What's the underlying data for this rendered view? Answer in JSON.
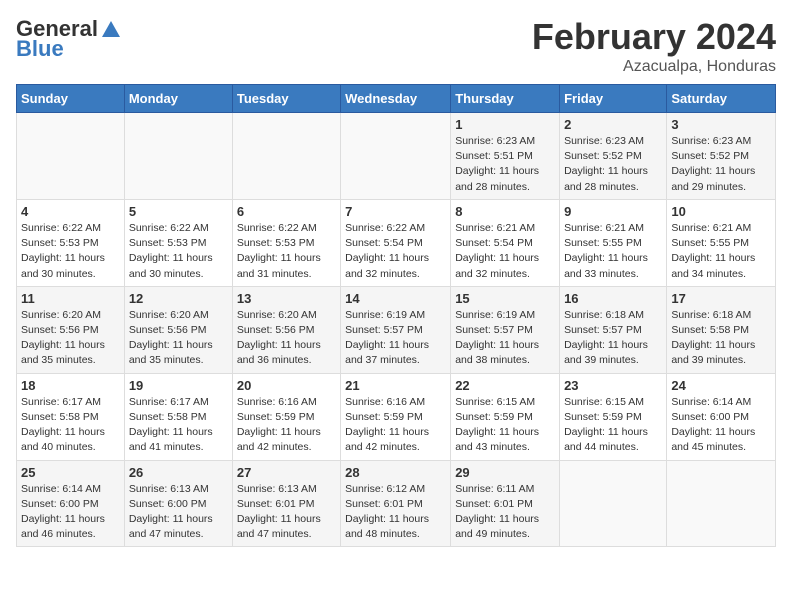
{
  "header": {
    "logo_general": "General",
    "logo_blue": "Blue",
    "title": "February 2024",
    "subtitle": "Azacualpa, Honduras"
  },
  "days_of_week": [
    "Sunday",
    "Monday",
    "Tuesday",
    "Wednesday",
    "Thursday",
    "Friday",
    "Saturday"
  ],
  "weeks": [
    [
      {
        "day": "",
        "info": ""
      },
      {
        "day": "",
        "info": ""
      },
      {
        "day": "",
        "info": ""
      },
      {
        "day": "",
        "info": ""
      },
      {
        "day": "1",
        "info": "Sunrise: 6:23 AM\nSunset: 5:51 PM\nDaylight: 11 hours and 28 minutes."
      },
      {
        "day": "2",
        "info": "Sunrise: 6:23 AM\nSunset: 5:52 PM\nDaylight: 11 hours and 28 minutes."
      },
      {
        "day": "3",
        "info": "Sunrise: 6:23 AM\nSunset: 5:52 PM\nDaylight: 11 hours and 29 minutes."
      }
    ],
    [
      {
        "day": "4",
        "info": "Sunrise: 6:22 AM\nSunset: 5:53 PM\nDaylight: 11 hours and 30 minutes."
      },
      {
        "day": "5",
        "info": "Sunrise: 6:22 AM\nSunset: 5:53 PM\nDaylight: 11 hours and 30 minutes."
      },
      {
        "day": "6",
        "info": "Sunrise: 6:22 AM\nSunset: 5:53 PM\nDaylight: 11 hours and 31 minutes."
      },
      {
        "day": "7",
        "info": "Sunrise: 6:22 AM\nSunset: 5:54 PM\nDaylight: 11 hours and 32 minutes."
      },
      {
        "day": "8",
        "info": "Sunrise: 6:21 AM\nSunset: 5:54 PM\nDaylight: 11 hours and 32 minutes."
      },
      {
        "day": "9",
        "info": "Sunrise: 6:21 AM\nSunset: 5:55 PM\nDaylight: 11 hours and 33 minutes."
      },
      {
        "day": "10",
        "info": "Sunrise: 6:21 AM\nSunset: 5:55 PM\nDaylight: 11 hours and 34 minutes."
      }
    ],
    [
      {
        "day": "11",
        "info": "Sunrise: 6:20 AM\nSunset: 5:56 PM\nDaylight: 11 hours and 35 minutes."
      },
      {
        "day": "12",
        "info": "Sunrise: 6:20 AM\nSunset: 5:56 PM\nDaylight: 11 hours and 35 minutes."
      },
      {
        "day": "13",
        "info": "Sunrise: 6:20 AM\nSunset: 5:56 PM\nDaylight: 11 hours and 36 minutes."
      },
      {
        "day": "14",
        "info": "Sunrise: 6:19 AM\nSunset: 5:57 PM\nDaylight: 11 hours and 37 minutes."
      },
      {
        "day": "15",
        "info": "Sunrise: 6:19 AM\nSunset: 5:57 PM\nDaylight: 11 hours and 38 minutes."
      },
      {
        "day": "16",
        "info": "Sunrise: 6:18 AM\nSunset: 5:57 PM\nDaylight: 11 hours and 39 minutes."
      },
      {
        "day": "17",
        "info": "Sunrise: 6:18 AM\nSunset: 5:58 PM\nDaylight: 11 hours and 39 minutes."
      }
    ],
    [
      {
        "day": "18",
        "info": "Sunrise: 6:17 AM\nSunset: 5:58 PM\nDaylight: 11 hours and 40 minutes."
      },
      {
        "day": "19",
        "info": "Sunrise: 6:17 AM\nSunset: 5:58 PM\nDaylight: 11 hours and 41 minutes."
      },
      {
        "day": "20",
        "info": "Sunrise: 6:16 AM\nSunset: 5:59 PM\nDaylight: 11 hours and 42 minutes."
      },
      {
        "day": "21",
        "info": "Sunrise: 6:16 AM\nSunset: 5:59 PM\nDaylight: 11 hours and 42 minutes."
      },
      {
        "day": "22",
        "info": "Sunrise: 6:15 AM\nSunset: 5:59 PM\nDaylight: 11 hours and 43 minutes."
      },
      {
        "day": "23",
        "info": "Sunrise: 6:15 AM\nSunset: 5:59 PM\nDaylight: 11 hours and 44 minutes."
      },
      {
        "day": "24",
        "info": "Sunrise: 6:14 AM\nSunset: 6:00 PM\nDaylight: 11 hours and 45 minutes."
      }
    ],
    [
      {
        "day": "25",
        "info": "Sunrise: 6:14 AM\nSunset: 6:00 PM\nDaylight: 11 hours and 46 minutes."
      },
      {
        "day": "26",
        "info": "Sunrise: 6:13 AM\nSunset: 6:00 PM\nDaylight: 11 hours and 47 minutes."
      },
      {
        "day": "27",
        "info": "Sunrise: 6:13 AM\nSunset: 6:01 PM\nDaylight: 11 hours and 47 minutes."
      },
      {
        "day": "28",
        "info": "Sunrise: 6:12 AM\nSunset: 6:01 PM\nDaylight: 11 hours and 48 minutes."
      },
      {
        "day": "29",
        "info": "Sunrise: 6:11 AM\nSunset: 6:01 PM\nDaylight: 11 hours and 49 minutes."
      },
      {
        "day": "",
        "info": ""
      },
      {
        "day": "",
        "info": ""
      }
    ]
  ]
}
